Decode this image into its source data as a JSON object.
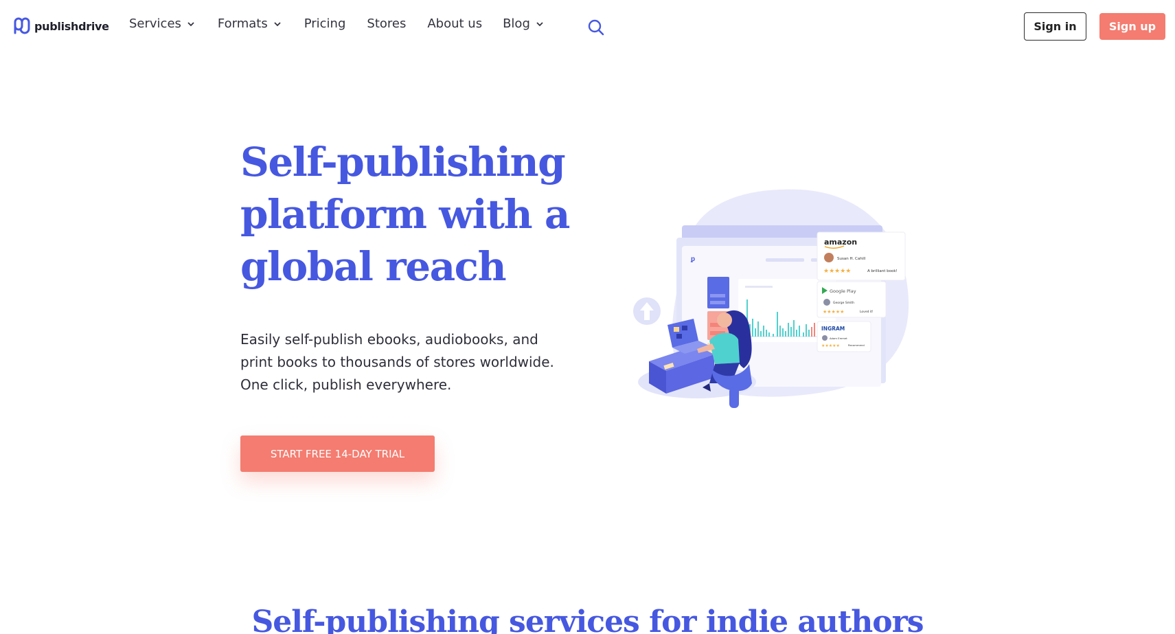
{
  "brand": {
    "name": "publishdrive",
    "accent": "#4658e0",
    "cta_color": "#f47c70"
  },
  "nav": {
    "items": [
      {
        "label": "Services",
        "has_dropdown": true
      },
      {
        "label": "Formats",
        "has_dropdown": true
      },
      {
        "label": "Pricing",
        "has_dropdown": false
      },
      {
        "label": "Stores",
        "has_dropdown": false
      },
      {
        "label": "About us",
        "has_dropdown": false
      },
      {
        "label": "Blog",
        "has_dropdown": true
      }
    ],
    "search_icon": "search-icon"
  },
  "auth": {
    "signin_label": "Sign in",
    "signup_label": "Sign up"
  },
  "hero": {
    "title_lines": [
      "Self-publishing",
      "platform with a",
      "global reach"
    ],
    "subtitle": "Easily self-publish ebooks, audiobooks, and print books to thousands of stores worldwide. One click, publish everywhere.",
    "cta_label": "START FREE 14-DAY TRIAL"
  },
  "illustration": {
    "reviews": [
      {
        "store": "amazon",
        "reviewer": "Susan H. Cahill",
        "rating": 5,
        "comment": "A brilliant book!"
      },
      {
        "store": "Google Play",
        "reviewer": "George Smith",
        "rating": 5,
        "comment": "Loved it!"
      },
      {
        "store": "INGRAM",
        "reviewer": "Adam Emmet",
        "rating": 5,
        "comment": "Recommend"
      }
    ]
  },
  "section": {
    "title": "Self-publishing services for indie authors"
  }
}
